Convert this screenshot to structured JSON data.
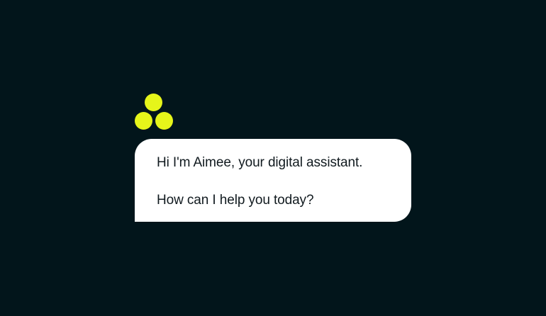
{
  "brand": {
    "accent_color": "#e6f51a",
    "background_color": "#02151b",
    "logo_icon": "three-dots-triangle-icon"
  },
  "message": {
    "greeting": "Hi I'm Aimee, your digital assistant.",
    "prompt": "How can I help you today?"
  }
}
